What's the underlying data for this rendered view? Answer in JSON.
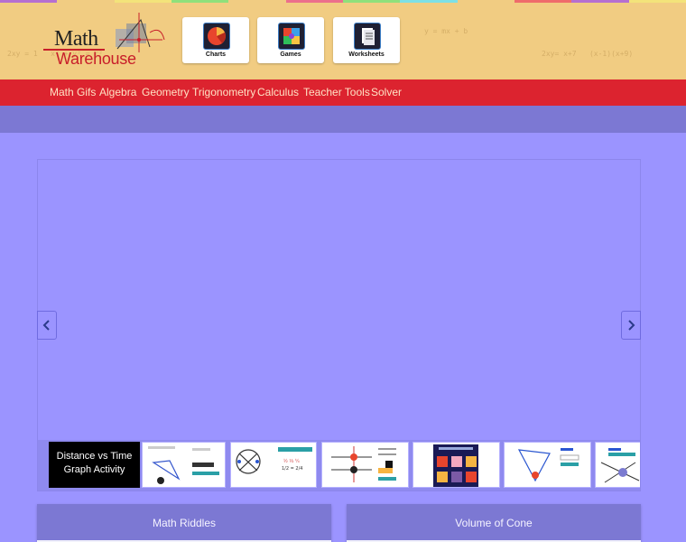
{
  "colors": {
    "header_bg": "#f1cc82",
    "nav_bg": "#dc232f",
    "page_bg": "#9b94ff",
    "band_bg": "#7c78d3",
    "strip": [
      "#b66fd0",
      "#f1cc82",
      "#f3e37a",
      "#8fe07b",
      "#f1cc82",
      "#ec6f8c",
      "#8fe07b",
      "#7de0e6",
      "#f1cc82",
      "#ef6b6b",
      "#b66fd0",
      "#f3e37a"
    ]
  },
  "logo": {
    "line1": "Math",
    "line2": "Warehouse"
  },
  "tiles": [
    {
      "label": "Charts",
      "icon": "pie-chart-icon"
    },
    {
      "label": "Games",
      "icon": "game-board-icon"
    },
    {
      "label": "Worksheets",
      "icon": "worksheets-icon"
    }
  ],
  "nav": {
    "items": [
      "Math Gifs",
      "Algebra",
      "Geometry",
      "Trigonometry",
      "Calculus",
      "Teacher Tools",
      "Solver"
    ]
  },
  "carousel": {
    "prev_icon": "chevron-left-icon",
    "next_icon": "chevron-right-icon",
    "active_thumb_title": "Distance vs Time Graph Activity",
    "thumb_icons": [
      "triangle-angle-thumbnail",
      "circle-chords-thumbnail",
      "fraction-practice-thumbnail",
      "parallel-lines-thumbnail",
      "volume-game-thumbnail",
      "triangle-proof-thumbnail",
      "intersecting-lines-thumbnail"
    ]
  },
  "cards": [
    {
      "title": "Math Riddles"
    },
    {
      "title": "Volume of Cone"
    }
  ]
}
